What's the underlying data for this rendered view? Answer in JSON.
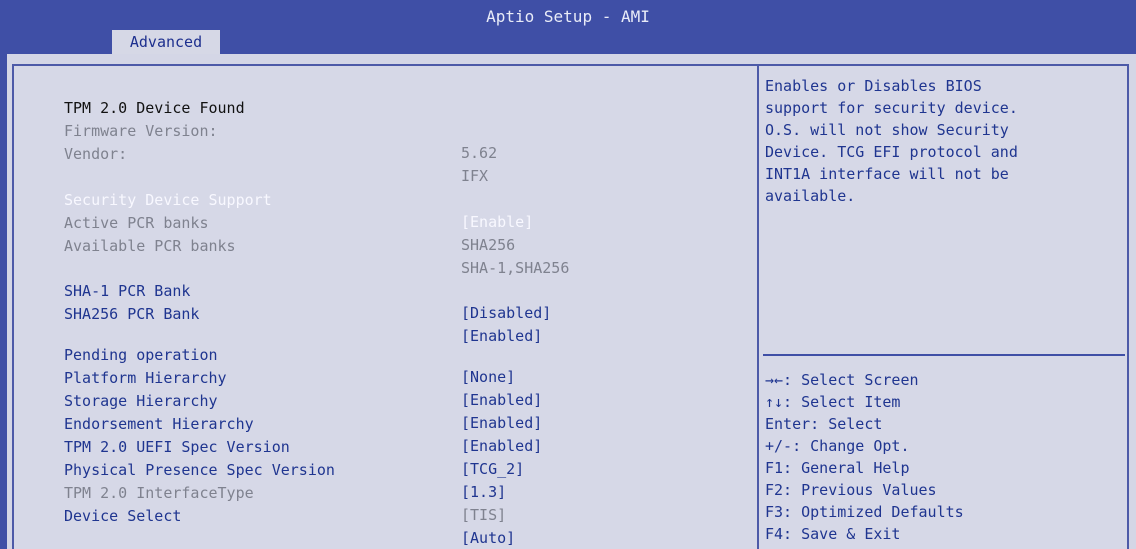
{
  "window": {
    "title": "Aptio Setup - AMI"
  },
  "tabs": [
    {
      "label": "Advanced"
    }
  ],
  "main": {
    "heading": "TPM 2.0 Device Found",
    "info": [
      {
        "label": "Firmware Version:",
        "value": "5.62"
      },
      {
        "label": "Vendor:",
        "value": "IFX"
      }
    ],
    "security": {
      "label": "Security Device Support",
      "value": "[Enable]"
    },
    "banks": [
      {
        "label": "Active PCR banks",
        "value": "SHA256"
      },
      {
        "label": "Available PCR banks",
        "value": "SHA-1,SHA256"
      }
    ],
    "pcr_options": [
      {
        "label": "SHA-1 PCR Bank",
        "value": "[Disabled]"
      },
      {
        "label": "SHA256 PCR Bank",
        "value": "[Enabled]"
      }
    ],
    "hierarchy_options": [
      {
        "label": "Pending operation",
        "value": "[None]"
      },
      {
        "label": "Platform Hierarchy",
        "value": "[Enabled]"
      },
      {
        "label": "Storage Hierarchy",
        "value": "[Enabled]"
      },
      {
        "label": "Endorsement Hierarchy",
        "value": "[Enabled]"
      },
      {
        "label": "TPM 2.0 UEFI Spec Version",
        "value": "[TCG_2]"
      },
      {
        "label": "Physical Presence Spec Version",
        "value": "[1.3]"
      },
      {
        "label": "TPM 2.0 InterfaceType",
        "value": "[TIS]"
      },
      {
        "label": "Device Select",
        "value": "[Auto]"
      }
    ]
  },
  "help": {
    "description": "Enables or Disables BIOS\nsupport for security device.\nO.S. will not show Security\nDevice. TCG EFI protocol and\nINT1A interface will not be\navailable.",
    "keys": [
      "→←: Select Screen",
      "↑↓: Select Item",
      "Enter: Select",
      "+/-: Change Opt.",
      "F1: General Help",
      "F2: Previous Values",
      "F3: Optimized Defaults",
      "F4: Save & Exit"
    ]
  },
  "colors": {
    "background": "#3f4fa6",
    "panel": "#d6d8e7",
    "text_blue": "#1f3590",
    "text_grey": "#7f828f",
    "selected": "#ffffff"
  }
}
